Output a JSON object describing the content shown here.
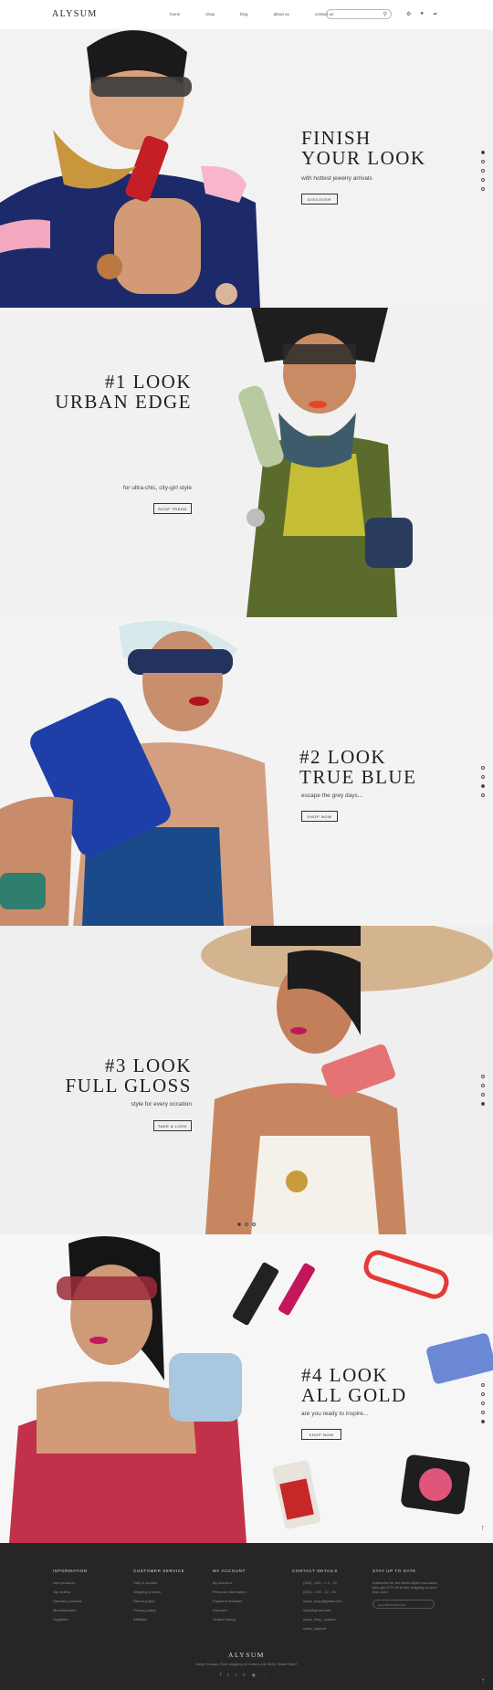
{
  "header": {
    "logo": "ALYSUM",
    "nav": [
      "home",
      "shop",
      "blog",
      "about us",
      "contact us"
    ],
    "search_placeholder": ""
  },
  "slides": [
    {
      "title_1": "FINISH",
      "title_2": "YOUR LOOK",
      "subtitle": "with hottest jewelry arrivals",
      "button": "DISCOVER"
    },
    {
      "title_1": "#1 LOOK",
      "title_2": "URBAN EDGE",
      "subtitle": "for ultra-chic, city-girl style",
      "button": "SHOP TREND"
    },
    {
      "title_1": "#2 LOOK",
      "title_2": "TRUE BLUE",
      "subtitle": "escape the grey days...",
      "button": "SHOP NOW"
    },
    {
      "title_1": "#3 LOOK",
      "title_2": "FULL GLOSS",
      "subtitle": "style for every occation",
      "button": "TAKE A LOOK"
    },
    {
      "title_1": "#4 LOOK",
      "title_2": "ALL GOLD",
      "subtitle": "are you ready to inspire...",
      "button": "SHOP NOW"
    }
  ],
  "footer": {
    "col1": {
      "title": "INFORMATION",
      "items": [
        "New products",
        "Top sellers",
        "Specials products",
        "Manufacturers",
        "Suppliers"
      ]
    },
    "col2": {
      "title": "CUSTOMER SERVICE",
      "items": [
        "Help & contact",
        "Shipping & taxes",
        "Return policy",
        "Privacy policy",
        "Affiliates"
      ]
    },
    "col3": {
      "title": "MY ACCOUNT",
      "items": [
        "My Account",
        "Personal information",
        "Payment methods",
        "Discount",
        "Orders history"
      ]
    },
    "col4": {
      "title": "CONTACT DETAILS",
      "items": [
        "(000) - 000 - 1 4 - 76",
        "(000) - 478 - 12 - 98",
        "nasty_shop@gmail.com",
        "lexiy@gmail.com",
        "nasty_shop_contact",
        "nasty_support"
      ]
    },
    "col5": {
      "title": "STAY UP TO DATE",
      "text": "Subscribe for the latest styles and sales, plus get 20% off & free shipping on your first order",
      "input_placeholder": "your@email.com"
    },
    "logo": "ALYSUM",
    "note": "Nasty Houses. Free shipping on orders over $100. Need Help?"
  },
  "colors": {
    "footer_bg": "#262626",
    "accent_red": "#c62828",
    "accent_blue": "#1e3fa8"
  }
}
